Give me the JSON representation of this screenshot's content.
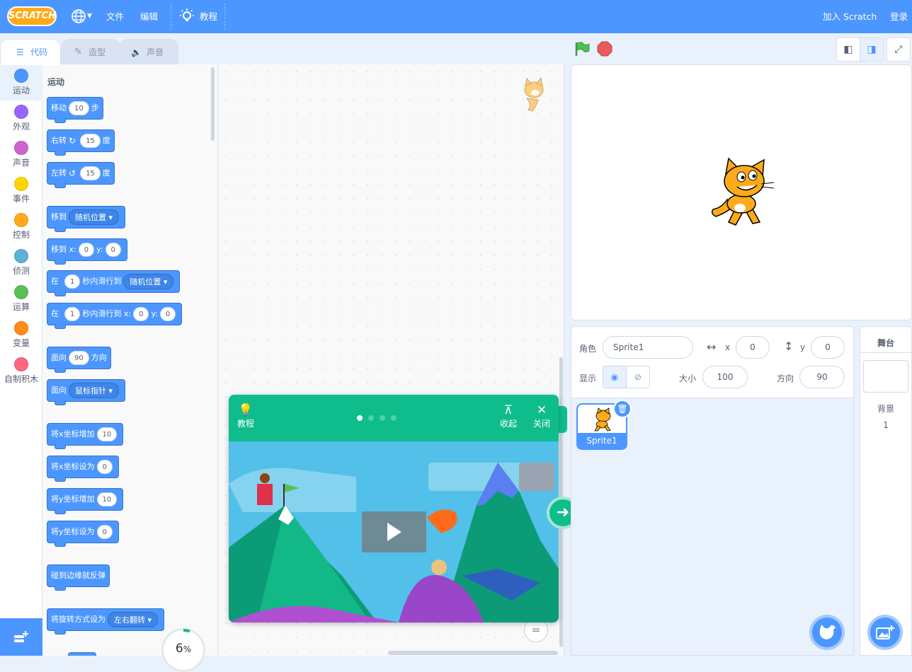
{
  "menubar": {
    "logo": "SCRATCH",
    "file": "文件",
    "edit": "编辑",
    "tutorials": "教程",
    "join": "加入 Scratch",
    "login": "登录"
  },
  "tabs": [
    {
      "label": "代码"
    },
    {
      "label": "造型"
    },
    {
      "label": "声音"
    }
  ],
  "categories": [
    {
      "label": "运动",
      "color": "#4c97ff"
    },
    {
      "label": "外观",
      "color": "#9966ff"
    },
    {
      "label": "声音",
      "color": "#cf63cf"
    },
    {
      "label": "事件",
      "color": "#ffd500"
    },
    {
      "label": "控制",
      "color": "#ffab19"
    },
    {
      "label": "侦测",
      "color": "#5cb1d6"
    },
    {
      "label": "运算",
      "color": "#59c059"
    },
    {
      "label": "变量",
      "color": "#ff8c1a"
    },
    {
      "label": "自制积木",
      "color": "#ff6680"
    }
  ],
  "palette": {
    "title": "运动",
    "blocks": {
      "move": {
        "a": "移动",
        "v": "10",
        "b": "步"
      },
      "turn_right": {
        "a": "右转",
        "v": "15",
        "b": "度"
      },
      "turn_left": {
        "a": "左转",
        "v": "15",
        "b": "度"
      },
      "goto": {
        "a": "移到",
        "dd": "随机位置"
      },
      "goto_xy": {
        "a": "移到 x:",
        "x": "0",
        "b": "y:",
        "y": "0"
      },
      "glide": {
        "a": "在",
        "v": "1",
        "b": "秒内滑行到",
        "dd": "随机位置"
      },
      "glide_xy": {
        "a": "在",
        "v": "1",
        "b": "秒内滑行到 x:",
        "x": "0",
        "c": "y:",
        "y": "0"
      },
      "point_dir": {
        "a": "面向",
        "v": "90",
        "b": "方向"
      },
      "point_towards": {
        "a": "面向",
        "dd": "鼠标指针"
      },
      "change_x": {
        "a": "将x坐标增加",
        "v": "10"
      },
      "set_x": {
        "a": "将x坐标设为",
        "v": "0"
      },
      "change_y": {
        "a": "将y坐标增加",
        "v": "10"
      },
      "set_y": {
        "a": "将y坐标设为",
        "v": "0"
      },
      "bounce": {
        "a": "碰到边缘就反弹"
      },
      "rotation": {
        "a": "将旋转方式设为",
        "dd": "左右翻转"
      }
    }
  },
  "progress": {
    "value": "6",
    "unit": "%"
  },
  "tutorial": {
    "label": "教程",
    "collapse": "收起",
    "close": "关闭",
    "pages": 4,
    "current_page": 1
  },
  "sprite_info": {
    "sprite_label": "角色",
    "sprite_name": "Sprite1",
    "x_label": "x",
    "x": "0",
    "y_label": "y",
    "y": "0",
    "show_label": "显示",
    "size_label": "大小",
    "size": "100",
    "direction_label": "方向",
    "direction": "90"
  },
  "sprites": [
    {
      "name": "Sprite1"
    }
  ],
  "stage_pane": {
    "title": "舞台",
    "backdrops_label": "背景",
    "backdrops_count": "1"
  },
  "colors": {
    "menubar": "#4c97ff",
    "tutorial": "#0fbd8c",
    "motion": "#4c97ff"
  }
}
